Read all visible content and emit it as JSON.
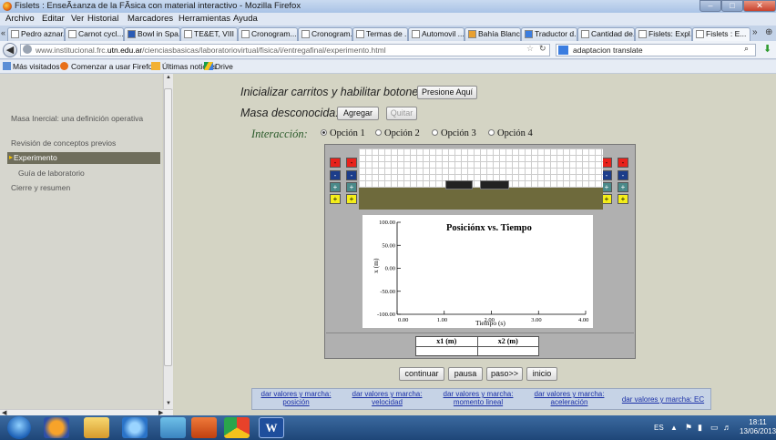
{
  "browser": {
    "title": "Fislets : EnseÃ±anza de la FÃ­sica con material interactivo - Mozilla Firefox",
    "window_controls": [
      "minimize",
      "maximize",
      "close"
    ],
    "menu": [
      "Archivo",
      "Editar",
      "Ver",
      "Historial",
      "Marcadores",
      "Herramientas",
      "Ayuda"
    ],
    "tabs": [
      "Pedro aznar...",
      "Carnot cycl...",
      "Bowl in Spa...",
      "TE&ET, VIII ...",
      "Cronogram...",
      "Cronogram...",
      "Termas de ...",
      "Automovil ...",
      "Bahía Blanc...",
      "Traductor d...",
      "Cantidad de...",
      "Fislets: Expl...",
      "Fislets : E..."
    ],
    "url_prefix": "www.institucional.frc.",
    "url_domain": "utn.edu.ar",
    "url_rest": "/cienciasbasicas/laboratoriovirtual/fisica/i/entregafinal/experimento.html",
    "search_value": "adaptacion translate",
    "bookmarks": [
      "Más visitados",
      "Comenzar a usar Firefox",
      "Últimas noticias",
      "Drive"
    ]
  },
  "sidebar": {
    "items": [
      "Masa Inercial: una definición operativa",
      "Revisión de conceptos previos",
      "Experimento",
      "Guía de laboratorio",
      "Cierre y resumen"
    ]
  },
  "controls": {
    "init_label": "Inicializar carritos y habilitar botones:",
    "init_button": "Presione Aquí",
    "mass_label": "Masa desconocida:",
    "add_button": "Agregar",
    "remove_button": "Quitar",
    "interaction_label": "Interacción:",
    "options": [
      "Opción 1",
      "Opción 2",
      "Opción 3",
      "Opción 4"
    ],
    "selected_option": "Opción 1"
  },
  "side_buttons": [
    "-",
    "-",
    "+",
    "+"
  ],
  "chart_data": {
    "type": "line",
    "title": "Posiciónx vs. Tiempo",
    "xlabel": "Tiempo (s)",
    "ylabel": "x (m)",
    "xlim": [
      0,
      4
    ],
    "ylim": [
      -100,
      100
    ],
    "x_ticks": [
      "0.00",
      "1.00",
      "2.00",
      "3.00",
      "4.00"
    ],
    "y_ticks": [
      "100.00",
      "50.00",
      "0.00",
      "-50.00",
      "-100.00"
    ],
    "series": []
  },
  "table": {
    "headers": [
      "x1 (m)",
      "x2 (m)"
    ],
    "values": [
      "",
      ""
    ]
  },
  "playback": [
    "continuar",
    "pausa",
    "paso>>",
    "inicio"
  ],
  "links": [
    "dar valores y marcha: posición",
    "dar valores y marcha: velocidad",
    "dar valores y marcha: momento lineal",
    "dar valores y marcha: aceleración",
    "dar valores y marcha: EC"
  ],
  "taskbar": {
    "lang": "ES",
    "time": "18:11",
    "date": "13/06/2013"
  }
}
